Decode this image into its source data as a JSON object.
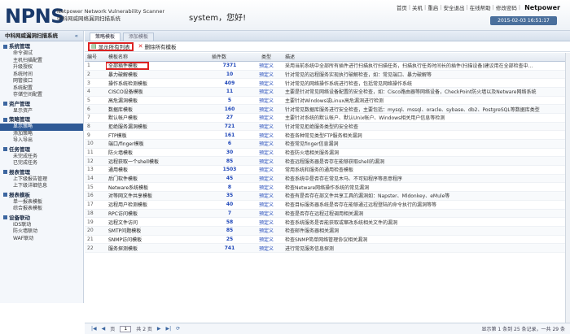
{
  "header": {
    "logo": "NPNS",
    "logo_en": "Netpower Network Vulnerability Scanner",
    "logo_cn": "中科网威网络漏洞扫描系统",
    "greeting": "system，您好!",
    "links": [
      "首页",
      "关机",
      "重启",
      "安全退出",
      "在线帮助",
      "修改密码"
    ],
    "brand": "Netpower",
    "datetime": "2015-02-03 16:51:17"
  },
  "sidebar": {
    "title": "中科网威漏洞扫描系统",
    "collapse": "«",
    "groups": [
      {
        "label": "系统管理",
        "items": [
          "命令调试",
          "主机扫描配置",
          "升级授权",
          "系统时间",
          "网管接口",
          "系统配置",
          "存储空间配置"
        ]
      },
      {
        "label": "资产管理",
        "items": [
          "显示资产"
        ]
      },
      {
        "label": "策略管理",
        "items": [
          "显示策略",
          "添加策略",
          "导入导出"
        ]
      },
      {
        "label": "任务管理",
        "items": [
          "未完成任务",
          "已完成任务"
        ]
      },
      {
        "label": "报表管理",
        "items": [
          "上下级报告管理",
          "上下级详细信息"
        ]
      },
      {
        "label": "报表模板",
        "items": [
          "单一报表模板",
          "综合报表模板"
        ]
      },
      {
        "label": "设备联动",
        "items": [
          "IDS联动",
          "防火墙联动",
          "WAF联动"
        ]
      }
    ],
    "active_item": "显示策略"
  },
  "tabs": [
    "策略模板",
    "添加模板"
  ],
  "toolbar": {
    "show_all": "显示所有列表",
    "delete": "删除所有模板"
  },
  "table": {
    "columns": [
      "编号",
      "模板名称",
      "插件数",
      "类型",
      "描述"
    ],
    "rows": [
      {
        "id": "1",
        "name": "全部插件模板",
        "count": "7371",
        "type": "预定义",
        "desc": "采用当前系统中全部所有插件进行扫描执行扫描任务，扫描执行任务时间长的插件(扫描设备)建议用在全部检查中..."
      },
      {
        "id": "2",
        "name": "暴力破解模板",
        "count": "10",
        "type": "预定义",
        "desc": "针对常见的远程服务实现执行破解检查，如：常见端口、暴力破解等"
      },
      {
        "id": "3",
        "name": "操作系统检测模板",
        "count": "409",
        "type": "预定义",
        "desc": "针对常见的网络操作系统进行检查，包括常见网络操作系统"
      },
      {
        "id": "4",
        "name": "CISCO设备模板",
        "count": "11",
        "type": "预定义",
        "desc": "主要是针对常见网络设备配置的安全检查，如：Cisco路由器等网络设备，CheckPoint防火墙以及Netware网络系统"
      },
      {
        "id": "5",
        "name": "高危漏洞模板",
        "count": "5",
        "type": "预定义",
        "desc": "主要针对Windows或Linux高危漏洞进行检测"
      },
      {
        "id": "6",
        "name": "数据库模板",
        "count": "160",
        "type": "预定义",
        "desc": "针对常见数据库服务进行安全检查，主要包括：mysql、mssql、oracle、sybase、db2、PostgreSQL等数据库类型"
      },
      {
        "id": "7",
        "name": "默认帐户模板",
        "count": "27",
        "type": "预定义",
        "desc": "主要针对系统的默认帐户、默认Unix帐户、Windows相关用户信息等检测"
      },
      {
        "id": "8",
        "name": "拒绝服务漏洞模板",
        "count": "721",
        "type": "预定义",
        "desc": "针对常见拒绝服务类型的安全检查"
      },
      {
        "id": "9",
        "name": "FTP模板",
        "count": "161",
        "type": "预定义",
        "desc": "检查各种常见类型FTP服务相关漏洞"
      },
      {
        "id": "10",
        "name": "端口/finger模板",
        "count": "6",
        "type": "预定义",
        "desc": "检查常见finger信息漏洞"
      },
      {
        "id": "11",
        "name": "防火墙模板",
        "count": "30",
        "type": "预定义",
        "desc": "检查防火墙相关服务漏洞"
      },
      {
        "id": "12",
        "name": "远程获取一个shell模板",
        "count": "85",
        "type": "预定义",
        "desc": "检查远程服务器是否存在能够获取shell的漏洞"
      },
      {
        "id": "13",
        "name": "通用模板",
        "count": "1503",
        "type": "预定义",
        "desc": "常用系统和服务的通用检查模板"
      },
      {
        "id": "14",
        "name": "后门软件模板",
        "count": "45",
        "type": "预定义",
        "desc": "检查系统中是否存在常见木马、不可知程序等恶意程序"
      },
      {
        "id": "15",
        "name": "Netware系统模板",
        "count": "8",
        "type": "预定义",
        "desc": "检查Netware网络操作系统的常见漏洞"
      },
      {
        "id": "16",
        "name": "对等网文件共享模板",
        "count": "35",
        "type": "预定义",
        "desc": "检查有是否存在部文件共享工具的漏洞如：Napster、Mldonkey、eMule等"
      },
      {
        "id": "17",
        "name": "远程用户检测模板",
        "count": "40",
        "type": "预定义",
        "desc": "检查目标服务器系统是否存在能够通过远程登陆的命令执行的漏洞等等"
      },
      {
        "id": "18",
        "name": "RPC访问模板",
        "count": "7",
        "type": "预定义",
        "desc": "检查是否存在远程过程调用相关漏洞"
      },
      {
        "id": "19",
        "name": "远程文件访问",
        "count": "58",
        "type": "预定义",
        "desc": "检查系统服务是否能获取或窜改系统相关文件的漏洞"
      },
      {
        "id": "20",
        "name": "SMTP问题模板",
        "count": "85",
        "type": "预定义",
        "desc": "检查邮件服务器相关漏洞"
      },
      {
        "id": "21",
        "name": "SNMP访问模板",
        "count": "25",
        "type": "预定义",
        "desc": "检查SNMP简单网络管理协议相关漏洞"
      },
      {
        "id": "22",
        "name": "服务探测模板",
        "count": "741",
        "type": "预定义",
        "desc": "进行常见服务信息探测"
      }
    ]
  },
  "footer": {
    "page_label": "页",
    "page_value": "1",
    "of_pages": "共 2 页",
    "info": "显示第 1 条到 25 条记录，一共 29 条"
  }
}
